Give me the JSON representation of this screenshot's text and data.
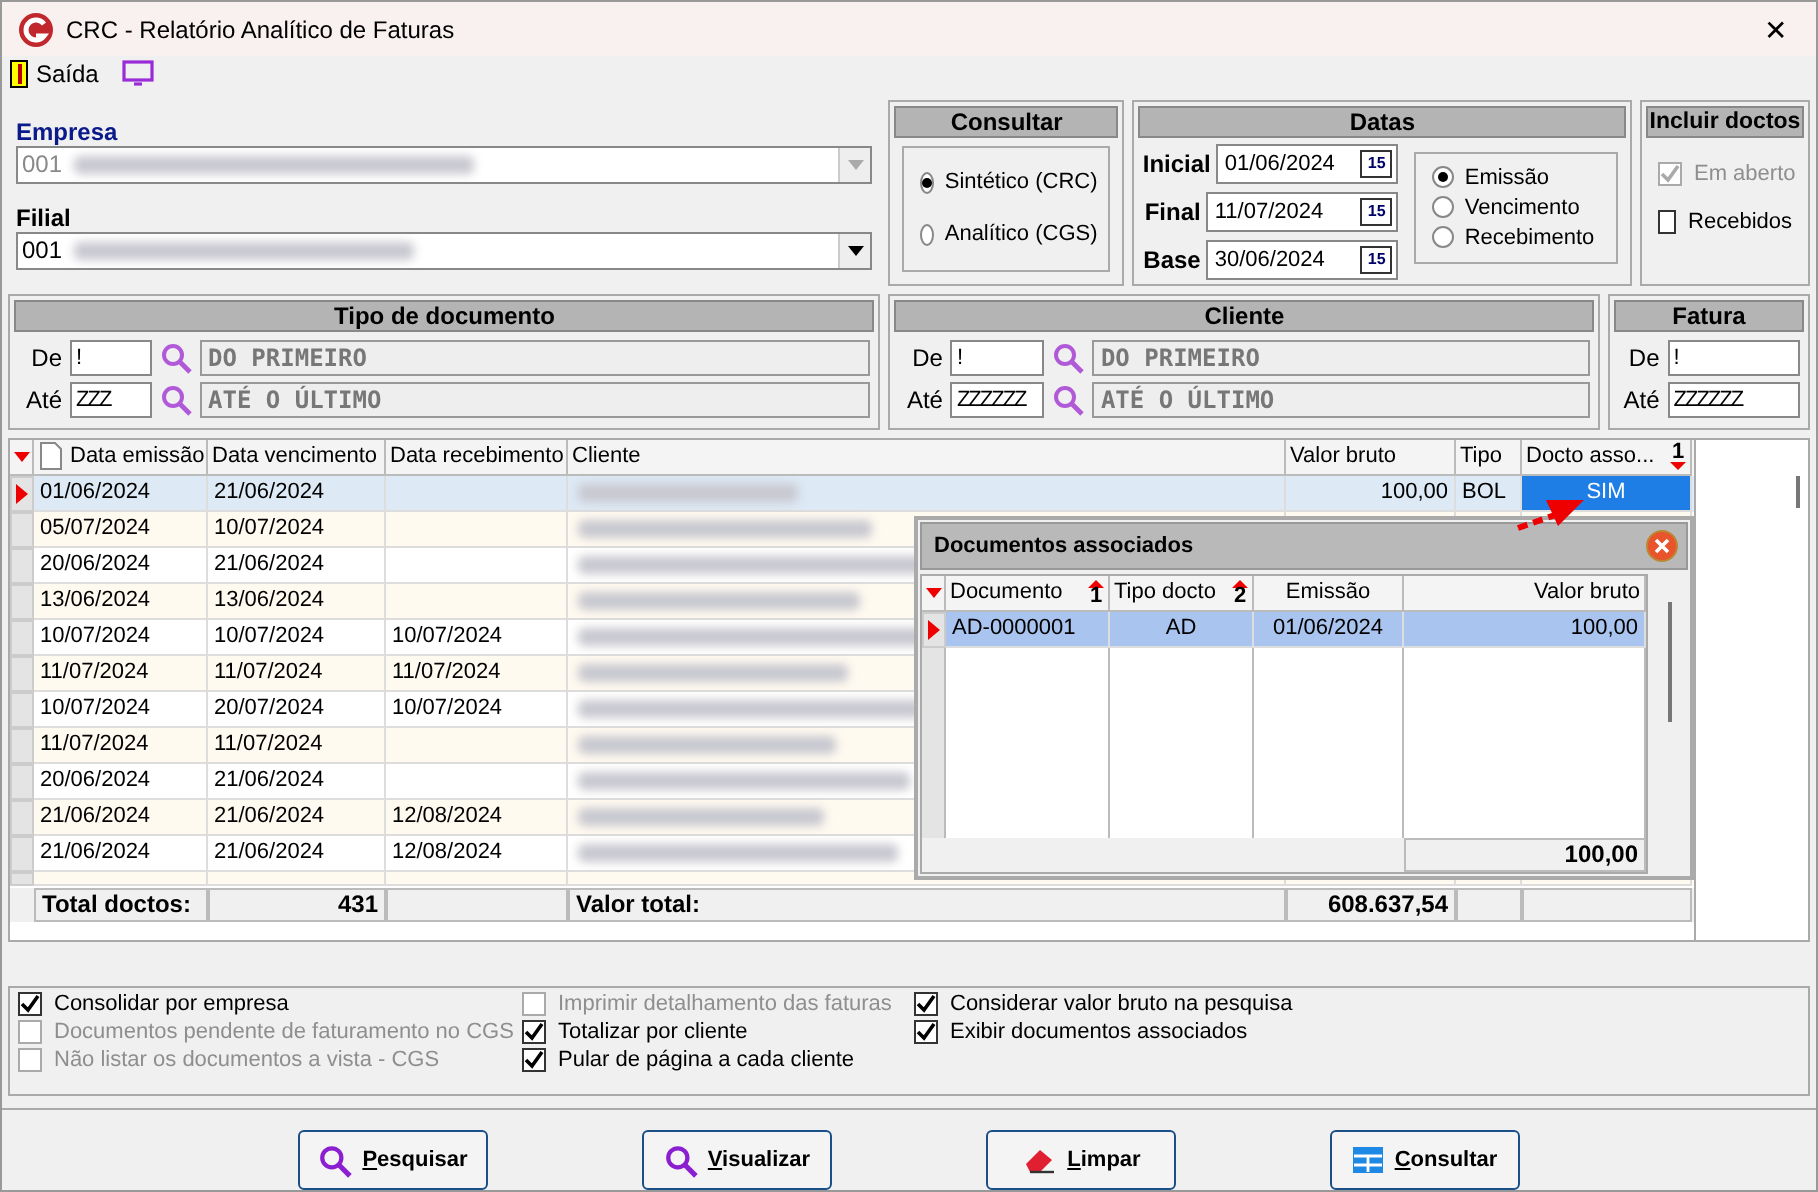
{
  "window": {
    "title": "CRC - Relatório Analítico de Faturas",
    "close": "✕"
  },
  "toolbar": {
    "exit_label": "Saída"
  },
  "empresa": {
    "label": "Empresa",
    "value": "001",
    "disabled": true
  },
  "filial": {
    "label": "Filial",
    "value": "001",
    "disabled": false
  },
  "consultar": {
    "title": "Consultar",
    "options": [
      {
        "label": "Sintético (CRC)",
        "selected": true
      },
      {
        "label": "Analítico (CGS)",
        "selected": false
      }
    ]
  },
  "datas": {
    "title": "Datas",
    "fields": [
      {
        "label": "Inicial",
        "value": "01/06/2024",
        "calendar": "15"
      },
      {
        "label": "Final",
        "value": "11/07/2024",
        "calendar": "15"
      },
      {
        "label": "Base",
        "value": "30/06/2024",
        "calendar": "15"
      }
    ],
    "options": [
      {
        "label": "Emissão",
        "selected": true
      },
      {
        "label": "Vencimento",
        "selected": false
      },
      {
        "label": "Recebimento",
        "selected": false
      }
    ]
  },
  "incluir": {
    "title": "Incluir doctos",
    "items": [
      {
        "label": "Em aberto",
        "checked": true,
        "disabled": true
      },
      {
        "label": "Recebidos",
        "checked": false,
        "disabled": false
      }
    ]
  },
  "tipo_documento": {
    "title": "Tipo de documento",
    "de": {
      "label": "De",
      "value": "!",
      "description": "DO PRIMEIRO"
    },
    "ate": {
      "label": "Até",
      "value": "ZZZ",
      "description": "ATÉ O ÚLTIMO"
    }
  },
  "cliente": {
    "title": "Cliente",
    "de": {
      "label": "De",
      "value": "!",
      "description": "DO PRIMEIRO"
    },
    "ate": {
      "label": "Até",
      "value": "ZZZZZZ",
      "description": "ATÉ O ÚLTIMO"
    }
  },
  "fatura": {
    "title": "Fatura",
    "de": {
      "label": "De",
      "value": "!"
    },
    "ate": {
      "label": "Até",
      "value": "ZZZZZZ"
    }
  },
  "table": {
    "columns": [
      {
        "label": "Data emissão"
      },
      {
        "label": "Data vencimento"
      },
      {
        "label": "Data recebimento"
      },
      {
        "label": "Cliente"
      },
      {
        "label": "Valor bruto"
      },
      {
        "label": "Tipo"
      },
      {
        "label": "Docto asso...",
        "sort": "1"
      }
    ],
    "rows": [
      {
        "selected": true,
        "cells": [
          "01/06/2024",
          "21/06/2024",
          "",
          "",
          "100,00",
          "BOL",
          "SIM"
        ]
      },
      {
        "selected": false,
        "cells": [
          "05/07/2024",
          "10/07/2024",
          ""
        ]
      },
      {
        "selected": false,
        "cells": [
          "20/06/2024",
          "21/06/2024",
          ""
        ]
      },
      {
        "selected": false,
        "cells": [
          "13/06/2024",
          "13/06/2024",
          ""
        ]
      },
      {
        "selected": false,
        "cells": [
          "10/07/2024",
          "10/07/2024",
          "10/07/2024"
        ]
      },
      {
        "selected": false,
        "cells": [
          "11/07/2024",
          "11/07/2024",
          "11/07/2024"
        ]
      },
      {
        "selected": false,
        "cells": [
          "10/07/2024",
          "20/07/2024",
          "10/07/2024"
        ]
      },
      {
        "selected": false,
        "cells": [
          "11/07/2024",
          "11/07/2024",
          ""
        ]
      },
      {
        "selected": false,
        "cells": [
          "20/06/2024",
          "21/06/2024",
          ""
        ]
      },
      {
        "selected": false,
        "cells": [
          "21/06/2024",
          "21/06/2024",
          "12/08/2024"
        ]
      },
      {
        "selected": false,
        "cells": [
          "21/06/2024",
          "21/06/2024",
          "12/08/2024"
        ]
      }
    ],
    "totals": {
      "count_label": "Total doctos:",
      "count": "431",
      "value_label": "Valor total:",
      "value": "608.637,54"
    }
  },
  "popup": {
    "title": "Documentos associados",
    "columns": [
      {
        "label": "Documento",
        "sort": "1"
      },
      {
        "label": "Tipo docto",
        "sort": "2"
      },
      {
        "label": "Emissão"
      },
      {
        "label": "Valor bruto"
      }
    ],
    "rows": [
      {
        "selected": true,
        "cells": [
          "AD-0000001",
          "AD",
          "01/06/2024",
          "100,00"
        ]
      }
    ],
    "total": "100,00"
  },
  "options": [
    [
      {
        "label": "Consolidar por empresa",
        "checked": true,
        "disabled": false
      },
      {
        "label": "Documentos pendente de faturamento no CGS",
        "checked": false,
        "disabled": true
      },
      {
        "label": "Não listar os documentos a vista - CGS",
        "checked": false,
        "disabled": true
      }
    ],
    [
      {
        "label": "Imprimir detalhamento das faturas",
        "checked": false,
        "disabled": true
      },
      {
        "label": "Totalizar por cliente",
        "checked": true,
        "disabled": false
      },
      {
        "label": "Pular de página a cada cliente",
        "checked": true,
        "disabled": false
      }
    ],
    [
      {
        "label": "Considerar valor bruto na pesquisa",
        "checked": true,
        "disabled": false
      },
      {
        "label": "Exibir documentos associados",
        "checked": true,
        "disabled": false
      }
    ]
  ],
  "buttons": [
    {
      "label": "Pesquisar",
      "kind": "search"
    },
    {
      "label": "Visualizar",
      "kind": "search"
    },
    {
      "label": "Limpar",
      "kind": "eraser"
    },
    {
      "label": "Consultar",
      "kind": "grid"
    }
  ]
}
